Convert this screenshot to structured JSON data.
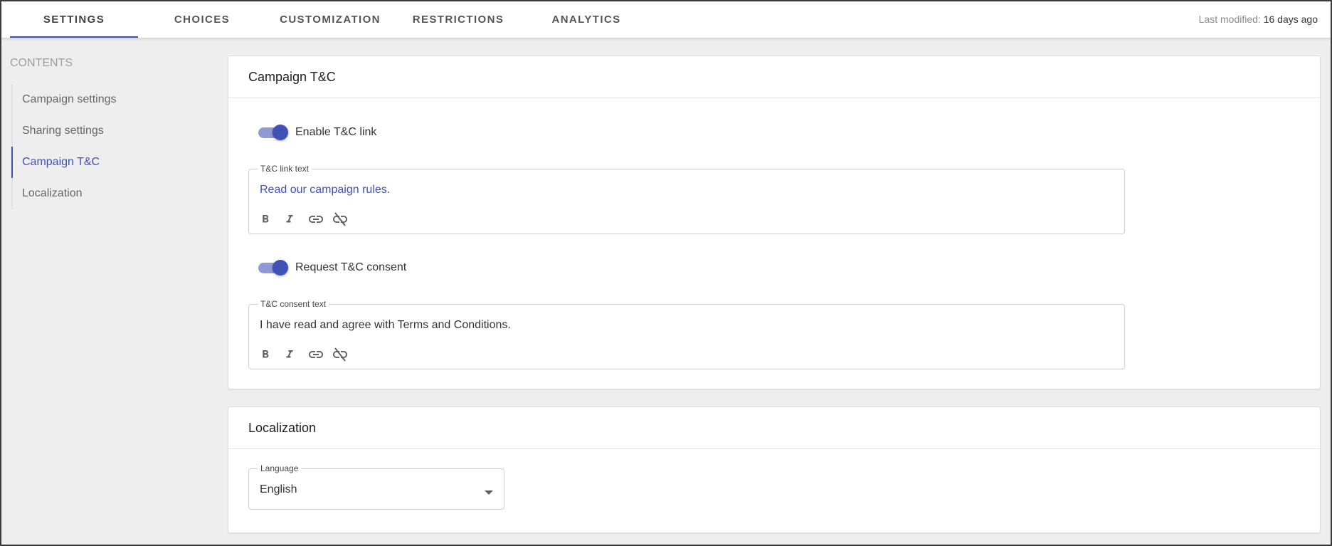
{
  "tabs": [
    {
      "label": "SETTINGS",
      "active": true
    },
    {
      "label": "CHOICES",
      "active": false
    },
    {
      "label": "CUSTOMIZATION",
      "active": false
    },
    {
      "label": "RESTRICTIONS",
      "active": false
    },
    {
      "label": "ANALYTICS",
      "active": false
    }
  ],
  "last_modified": {
    "label": "Last modified:",
    "value": "16 days ago"
  },
  "sidebar": {
    "title": "CONTENTS",
    "items": [
      {
        "label": "Campaign settings",
        "active": false
      },
      {
        "label": "Sharing settings",
        "active": false
      },
      {
        "label": "Campaign T&C",
        "active": true
      },
      {
        "label": "Localization",
        "active": false
      }
    ]
  },
  "tc_section": {
    "title": "Campaign T&C",
    "enable_link_toggle": {
      "label": "Enable T&C link",
      "on": true
    },
    "link_text_field": {
      "label": "T&C link text",
      "value": "Read our campaign rules."
    },
    "consent_toggle": {
      "label": "Request T&C consent",
      "on": true
    },
    "consent_text_field": {
      "label": "T&C consent text",
      "value": "I have read and agree with Terms and Conditions."
    },
    "toolbar_icons": [
      "bold-icon",
      "italic-icon",
      "link-icon",
      "unlink-icon"
    ]
  },
  "localization_section": {
    "title": "Localization",
    "language_field": {
      "label": "Language",
      "value": "English"
    }
  },
  "colors": {
    "accent": "#3f51b5",
    "accent_track": "#8f99d6"
  }
}
